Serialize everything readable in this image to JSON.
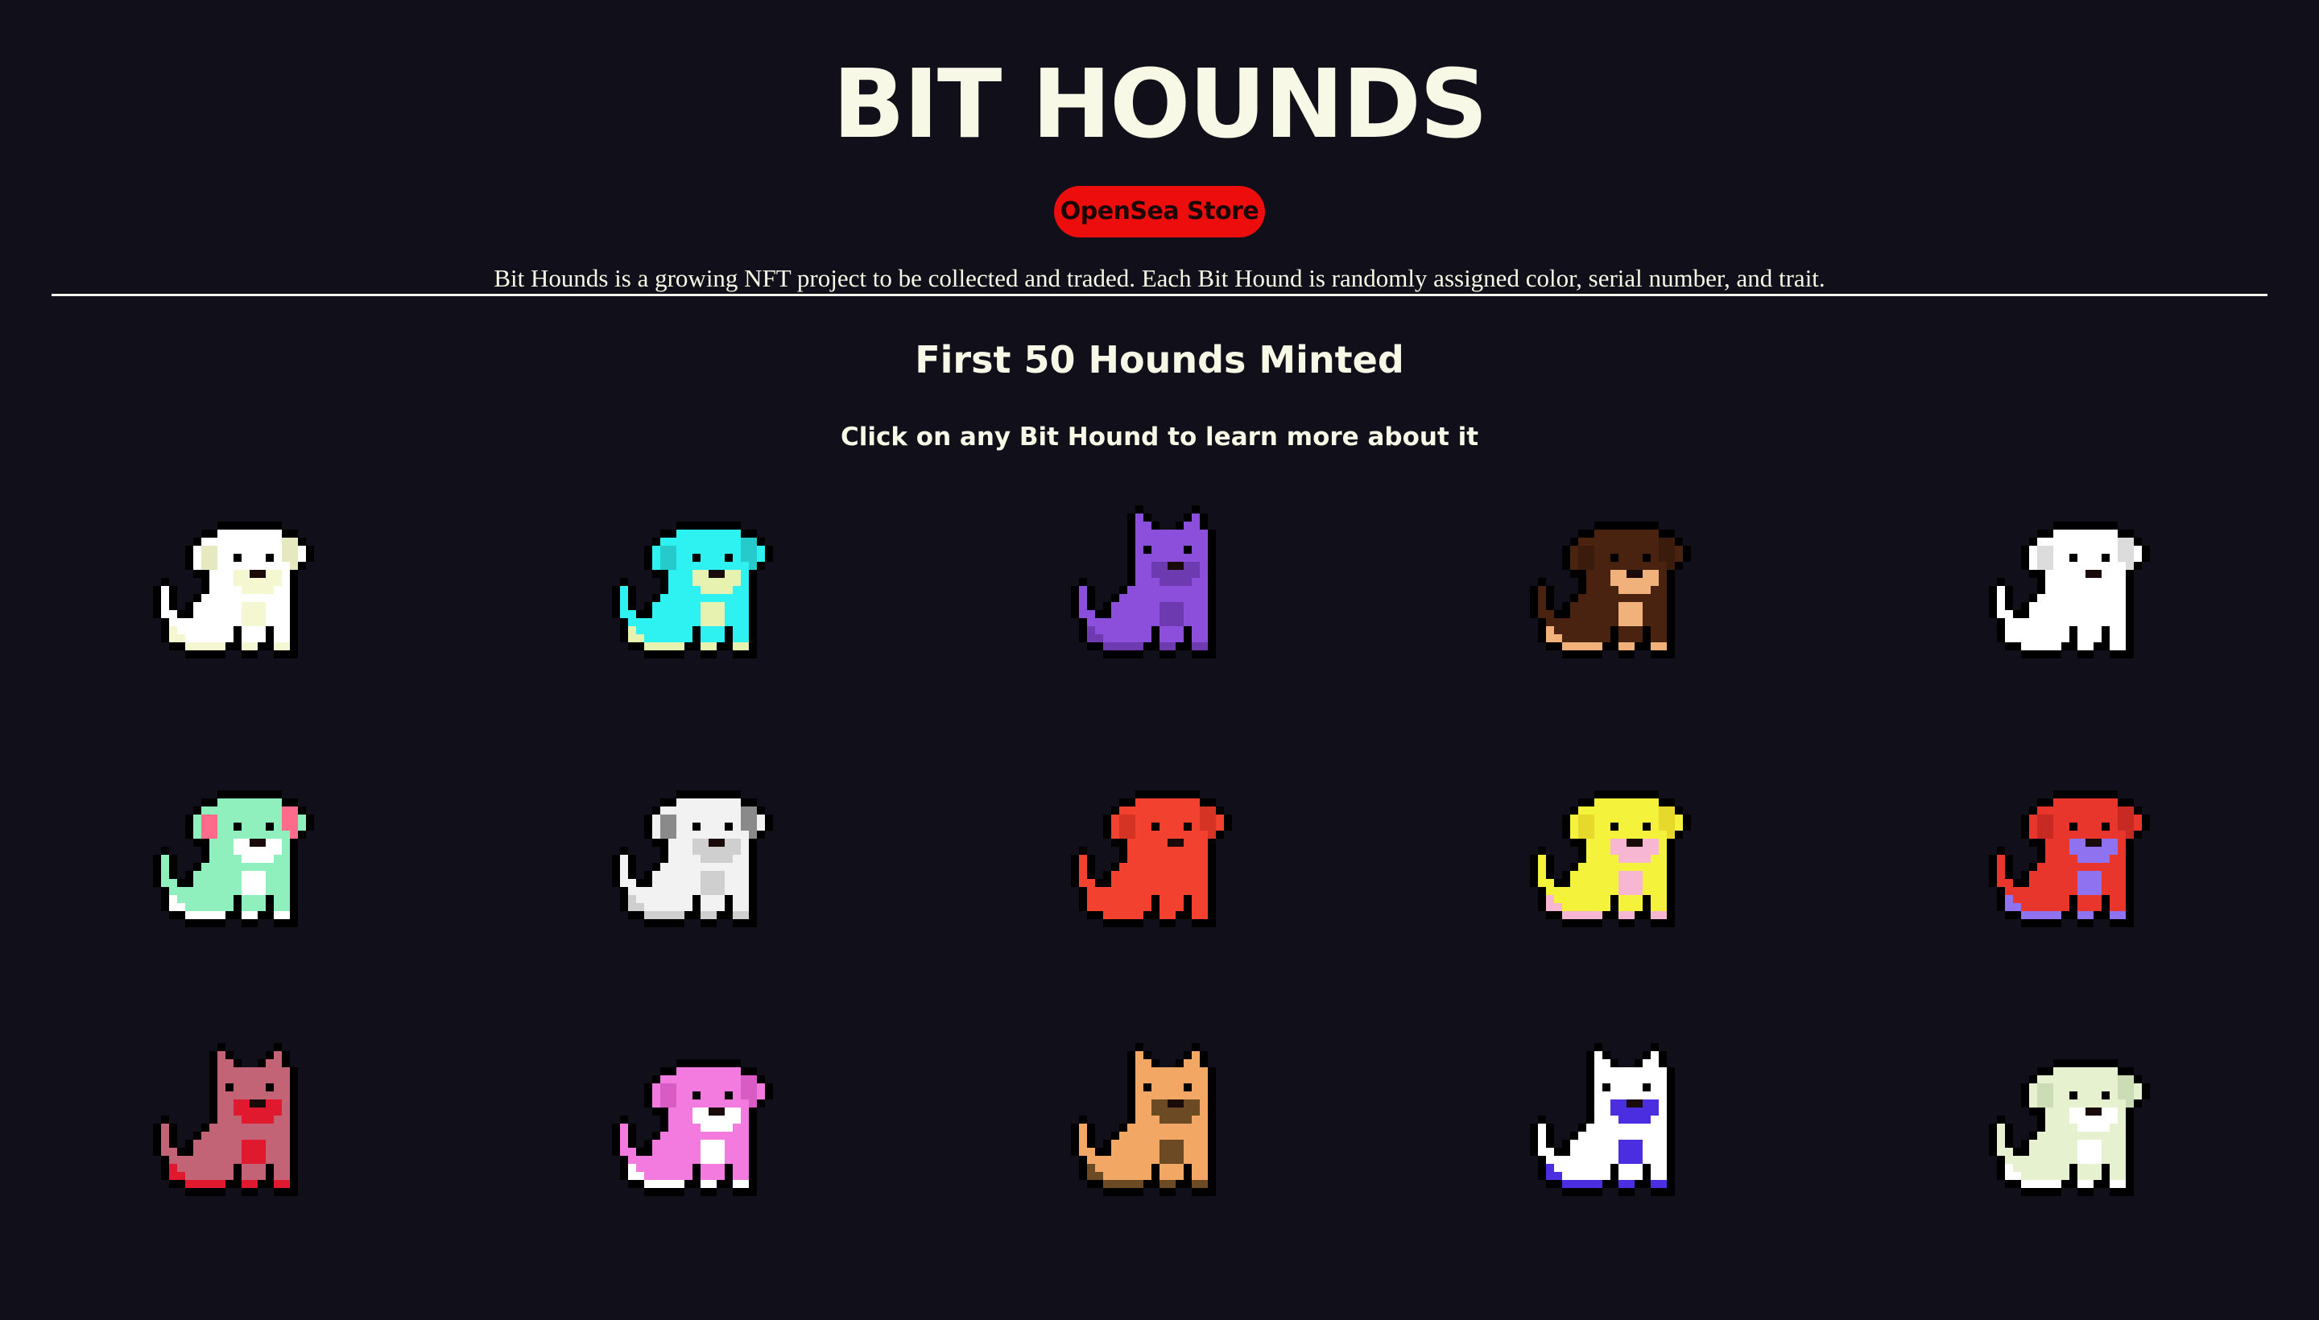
{
  "header": {
    "title": "BIT HOUNDS",
    "store_label": "OpenSea Store",
    "description": "Bit Hounds is a growing NFT project to be collected and traded. Each Bit Hound is randomly assigned color, serial number, and trait."
  },
  "section": {
    "title": "First 50 Hounds Minted",
    "subtitle": "Click on any Bit Hound to learn more about it"
  },
  "colors": {
    "background": "#11101a",
    "text": "#f7f9e6",
    "store_button": "#ee0d0d"
  },
  "hounds": [
    {
      "ears": "floppy",
      "body": "#ffffff",
      "accent": "#f4f7cf",
      "marks": "#e6e9c0"
    },
    {
      "ears": "floppy",
      "body": "#2ef2f2",
      "accent": "#e7f2b0",
      "marks": "#27caca"
    },
    {
      "ears": "pointy",
      "body": "#8c4fdc",
      "accent": "#6d3ab0",
      "marks": "#7a44c4"
    },
    {
      "ears": "floppy",
      "body": "#4a2310",
      "accent": "#f0b27a",
      "marks": "#3b1b0b"
    },
    {
      "ears": "floppy",
      "body": "#ffffff",
      "accent": "#ffffff",
      "marks": "#dcdcdc"
    },
    {
      "ears": "floppy",
      "body": "#8ff0bd",
      "accent": "#ffffff",
      "marks": "#ff6b8a"
    },
    {
      "ears": "floppy",
      "body": "#f2f2f2",
      "accent": "#cfcfcf",
      "marks": "#8a8a8a"
    },
    {
      "ears": "floppy",
      "body": "#f2412f",
      "accent": "#f2412f",
      "marks": "#d53424"
    },
    {
      "ears": "floppy",
      "body": "#f4f23a",
      "accent": "#f7b6d2",
      "marks": "#e7d82c"
    },
    {
      "ears": "floppy",
      "body": "#e8362d",
      "accent": "#8f72f0",
      "marks": "#c72a22"
    },
    {
      "ears": "pointy",
      "body": "#c26476",
      "accent": "#e0192e",
      "marks": "#a9485a"
    },
    {
      "ears": "floppy",
      "body": "#f37bdf",
      "accent": "#ffffff",
      "marks": "#d85cc3"
    },
    {
      "ears": "pointy",
      "body": "#f2a764",
      "accent": "#6b4a24",
      "marks": "#d98c4a"
    },
    {
      "ears": "pointy",
      "body": "#ffffff",
      "accent": "#4a2ee0",
      "marks": "#c9dcf5"
    },
    {
      "ears": "floppy",
      "body": "#e6f2cf",
      "accent": "#ffffff",
      "marks": "#ccdcb4"
    }
  ]
}
